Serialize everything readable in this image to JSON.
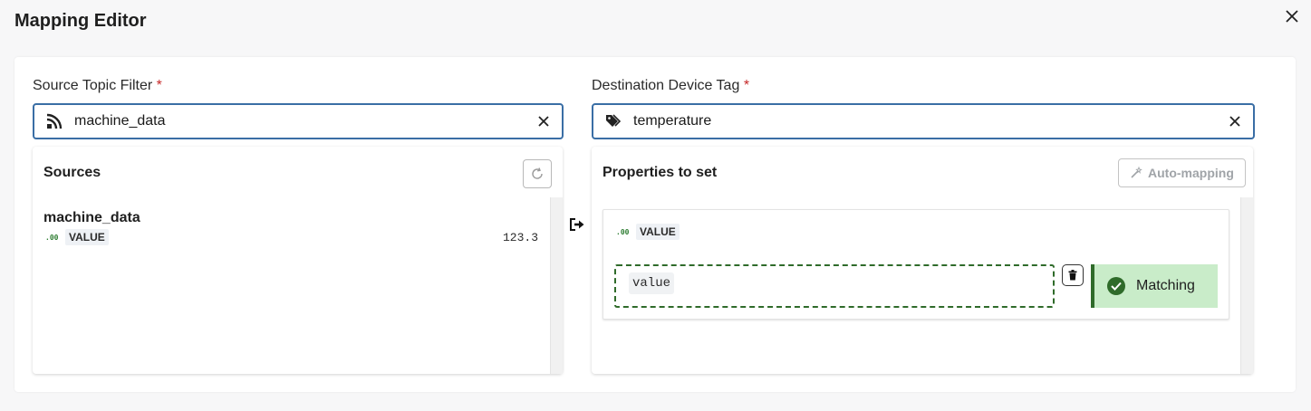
{
  "dialog": {
    "title": "Mapping Editor"
  },
  "source_filter": {
    "label": "Source Topic Filter",
    "required_mark": "*",
    "value": "machine_data"
  },
  "destination_tag": {
    "label": "Destination Device Tag",
    "required_mark": "*",
    "value": "temperature"
  },
  "sources_panel": {
    "title": "Sources",
    "items": [
      {
        "name": "machine_data",
        "type_glyph": ".00",
        "type": "VALUE",
        "value": "123.3"
      }
    ]
  },
  "properties_panel": {
    "title": "Properties to set",
    "auto_mapping_label": "Auto-mapping",
    "property": {
      "type_glyph": ".00",
      "type": "VALUE",
      "mapped_field": "value",
      "status": "Matching"
    }
  },
  "colors": {
    "accent_border": "#3a6ea5",
    "required": "#c62828",
    "match_green": "#2f6b2a",
    "match_bg": "#c9ecc9"
  },
  "icons": {
    "close": "close-icon",
    "source_lead": "rss-feed-icon",
    "tag_lead": "tags-icon",
    "clear": "clear-icon",
    "refresh": "refresh-icon",
    "link": "arrow-into-icon",
    "auto": "magic-wand-icon",
    "trash": "trash-icon",
    "check": "check-circle-icon"
  }
}
